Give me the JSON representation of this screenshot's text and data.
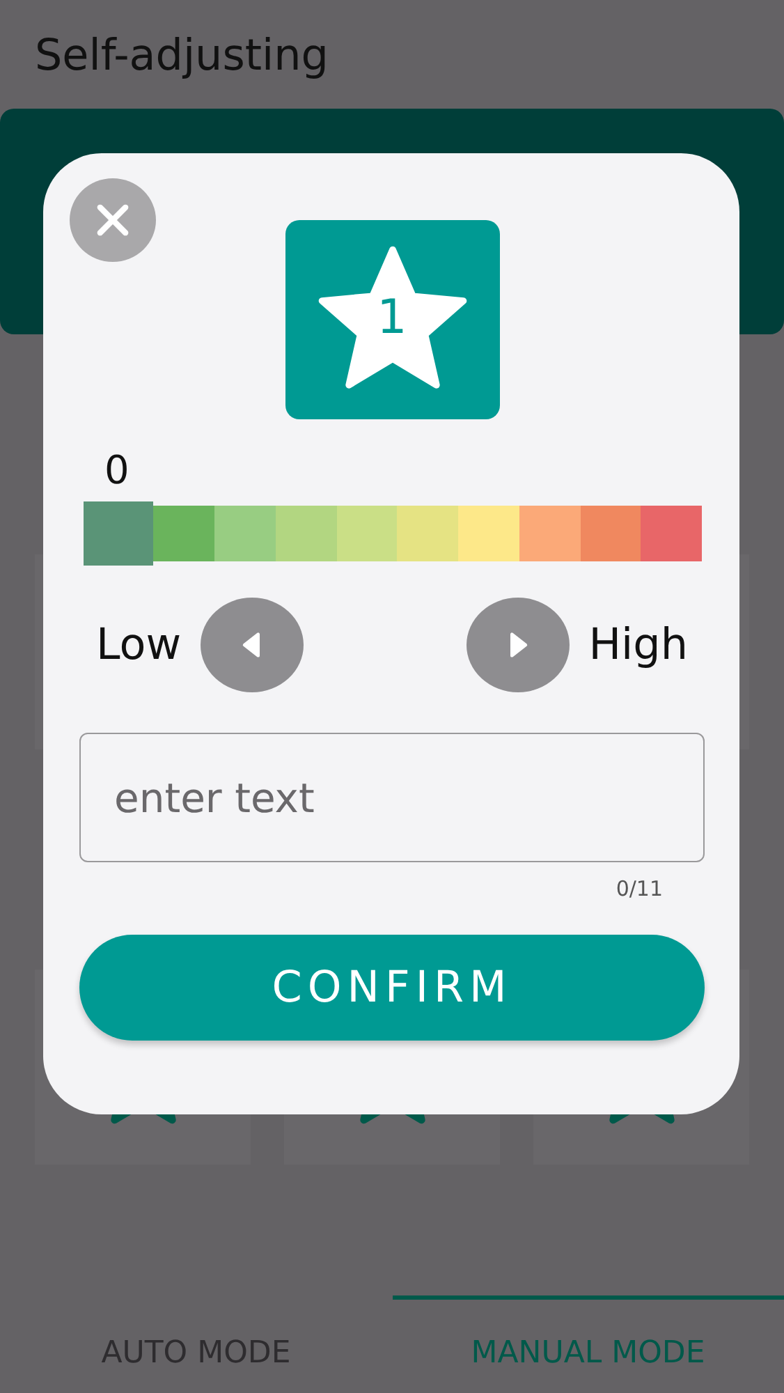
{
  "page": {
    "title": "Self-adjusting"
  },
  "tabs": [
    {
      "label": "AUTO MODE",
      "selected": false
    },
    {
      "label": "MANUAL MODE",
      "selected": true
    }
  ],
  "dialog": {
    "badge": "1",
    "scale_value": "0",
    "scale": [
      {
        "color": "#5a9477",
        "selected": true
      },
      {
        "color": "#6ab45c",
        "selected": false
      },
      {
        "color": "#98cd82",
        "selected": false
      },
      {
        "color": "#b2d681",
        "selected": false
      },
      {
        "color": "#cadf86",
        "selected": false
      },
      {
        "color": "#e5e383",
        "selected": false
      },
      {
        "color": "#fde889",
        "selected": false
      },
      {
        "color": "#fba978",
        "selected": false
      },
      {
        "color": "#f0885f",
        "selected": false
      },
      {
        "color": "#e86668",
        "selected": false
      }
    ],
    "low_label": "Low",
    "high_label": "High",
    "input": {
      "placeholder": "enter text"
    },
    "counter": "0/11",
    "confirm": "CONFIRM"
  }
}
